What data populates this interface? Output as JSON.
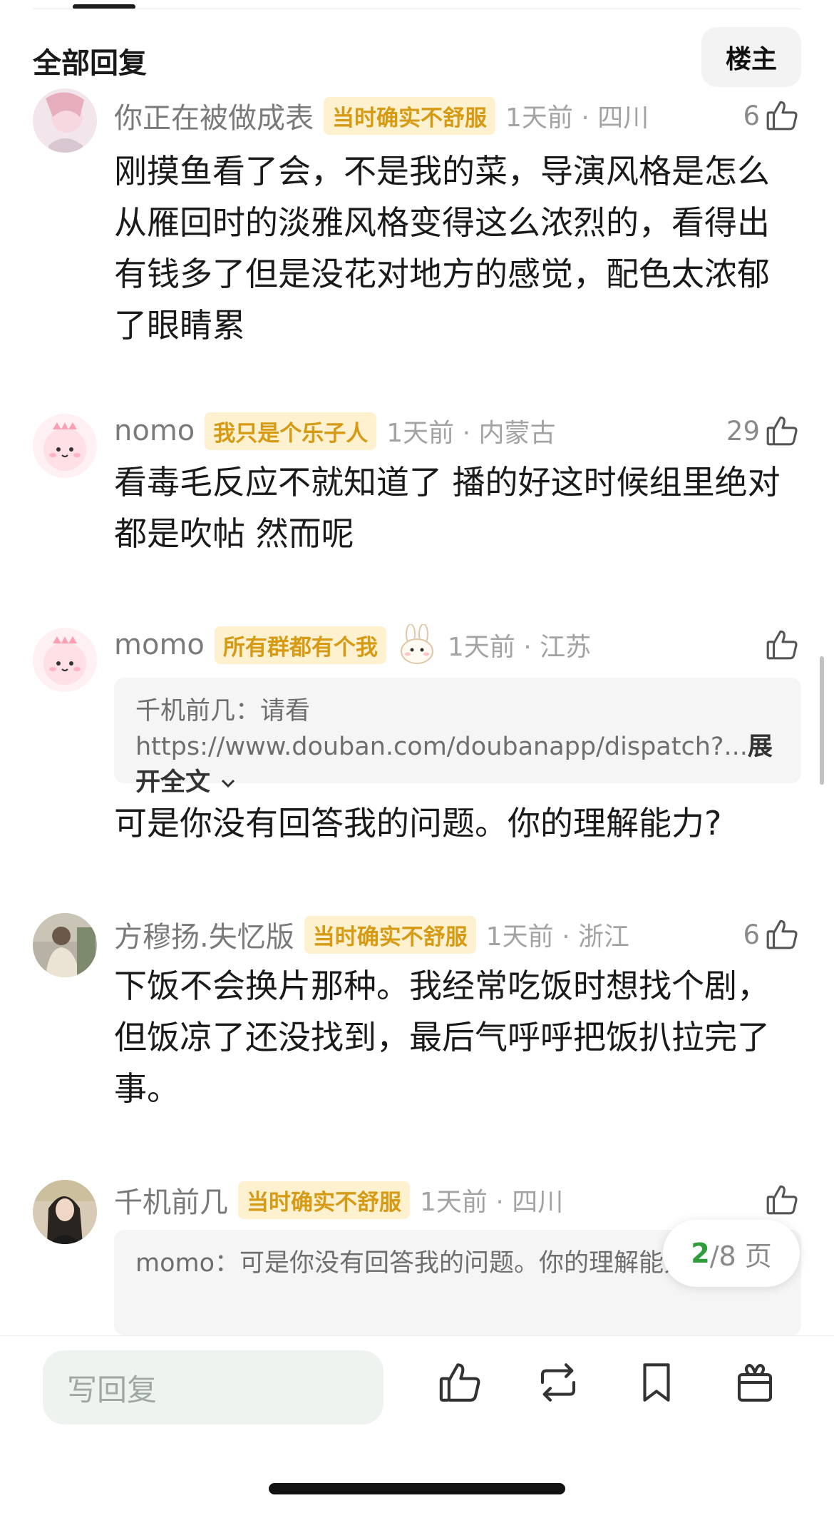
{
  "header": {
    "title": "全部回复",
    "sort_label": "楼主"
  },
  "comments": [
    {
      "username": "你正在被做成表",
      "badge": "当时确实不舒服",
      "time": "1天前 · 四川",
      "likes": "6",
      "text": "刚摸鱼看了会，不是我的菜，导演风格是怎么从雁回时的淡雅风格变得这么浓烈的，看得出有钱多了但是没花对地方的感觉，配色太浓郁了眼睛累"
    },
    {
      "username": "nomo",
      "badge": "我只是个乐子人",
      "time": "1天前 · 内蒙古",
      "likes": "29",
      "text": "看毒毛反应不就知道了 播的好这时候组里绝对都是吹帖 然而呢"
    },
    {
      "username": "momo",
      "badge": "所有群都有个我",
      "time": "1天前 · 江苏",
      "likes": "",
      "quote": "千机前几：请看https://www.douban.com/doubanapp/dispatch?...",
      "expand": "展开全文",
      "text": "可是你没有回答我的问题。你的理解能力?"
    },
    {
      "username": "方穆扬.失忆版",
      "badge": "当时确实不舒服",
      "time": "1天前 · 浙江",
      "likes": "6",
      "text": "下饭不会换片那种。我经常吃饭时想找个剧，但饭凉了还没找到，最后气呼呼把饭扒拉完了事。"
    },
    {
      "username": "千机前几",
      "badge": "当时确实不舒服",
      "time": "1天前 · 四川",
      "likes": "",
      "quote": "momo：可是你没有回答我的问题。你的理解能力?"
    }
  ],
  "pager": {
    "current": "2",
    "total": "/8 页"
  },
  "bottom_bar": {
    "reply_placeholder": "写回复",
    "actions": [
      "like-icon",
      "repost-icon",
      "bookmark-icon",
      "gift-icon"
    ]
  },
  "colors": {
    "badge_bg": "#fdf1cf",
    "badge_text": "#d69a14",
    "pager_accent": "#2e9d3a"
  }
}
